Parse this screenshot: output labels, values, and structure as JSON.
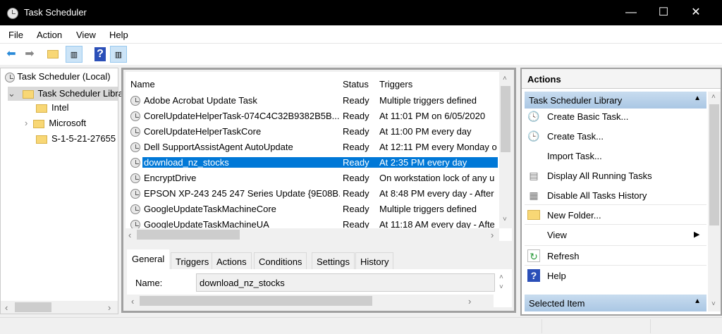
{
  "window": {
    "title": "Task Scheduler",
    "minimize": "—",
    "maximize": "☐",
    "close": "✕"
  },
  "menu": [
    "File",
    "Action",
    "View",
    "Help"
  ],
  "toolbar": {
    "back": "back-arrow-icon",
    "forward": "forward-arrow-icon",
    "help": "?"
  },
  "tree": {
    "root": "Task Scheduler (Local)",
    "library": "Task Scheduler Library",
    "children": [
      "Intel",
      "Microsoft",
      "S-1-5-21-27655"
    ]
  },
  "list": {
    "columns": [
      "Name",
      "Status",
      "Triggers"
    ],
    "rows": [
      {
        "name": "Adobe Acrobat Update Task",
        "status": "Ready",
        "triggers": "Multiple triggers defined"
      },
      {
        "name": "CorelUpdateHelperTask-074C4C32B9382B5B...",
        "status": "Ready",
        "triggers": "At 11:01 PM on 6/05/2020"
      },
      {
        "name": "CorelUpdateHelperTaskCore",
        "status": "Ready",
        "triggers": "At 11:00 PM every day"
      },
      {
        "name": "Dell SupportAssistAgent AutoUpdate",
        "status": "Ready",
        "triggers": "At 12:11 PM every Monday o"
      },
      {
        "name": "download_nz_stocks",
        "status": "Ready",
        "triggers": "At 2:35 PM every day"
      },
      {
        "name": "EncryptDrive",
        "status": "Ready",
        "triggers": "On workstation lock of any u"
      },
      {
        "name": "EPSON XP-243 245 247 Series Update {9E08B...",
        "status": "Ready",
        "triggers": "At 8:48 PM every day - After"
      },
      {
        "name": "GoogleUpdateTaskMachineCore",
        "status": "Ready",
        "triggers": "Multiple triggers defined"
      },
      {
        "name": "GoogleUpdateTaskMachineUA",
        "status": "Ready",
        "triggers": "At 11:18 AM every day - Afte"
      }
    ],
    "selected_index": 4
  },
  "details": {
    "tabs": [
      "General",
      "Triggers",
      "Actions",
      "Conditions",
      "Settings",
      "History"
    ],
    "active_tab": "General",
    "name_label": "Name:",
    "name_value": "download_nz_stocks"
  },
  "actions": {
    "title": "Actions",
    "section1": "Task Scheduler Library",
    "items": [
      "Create Basic Task...",
      "Create Task...",
      "Import Task...",
      "Display All Running Tasks",
      "Disable All Tasks History",
      "New Folder...",
      "View",
      "Refresh",
      "Help"
    ],
    "section2": "Selected Item"
  },
  "colors": {
    "selection": "#0078d7",
    "section_header": "#b4cde8"
  }
}
